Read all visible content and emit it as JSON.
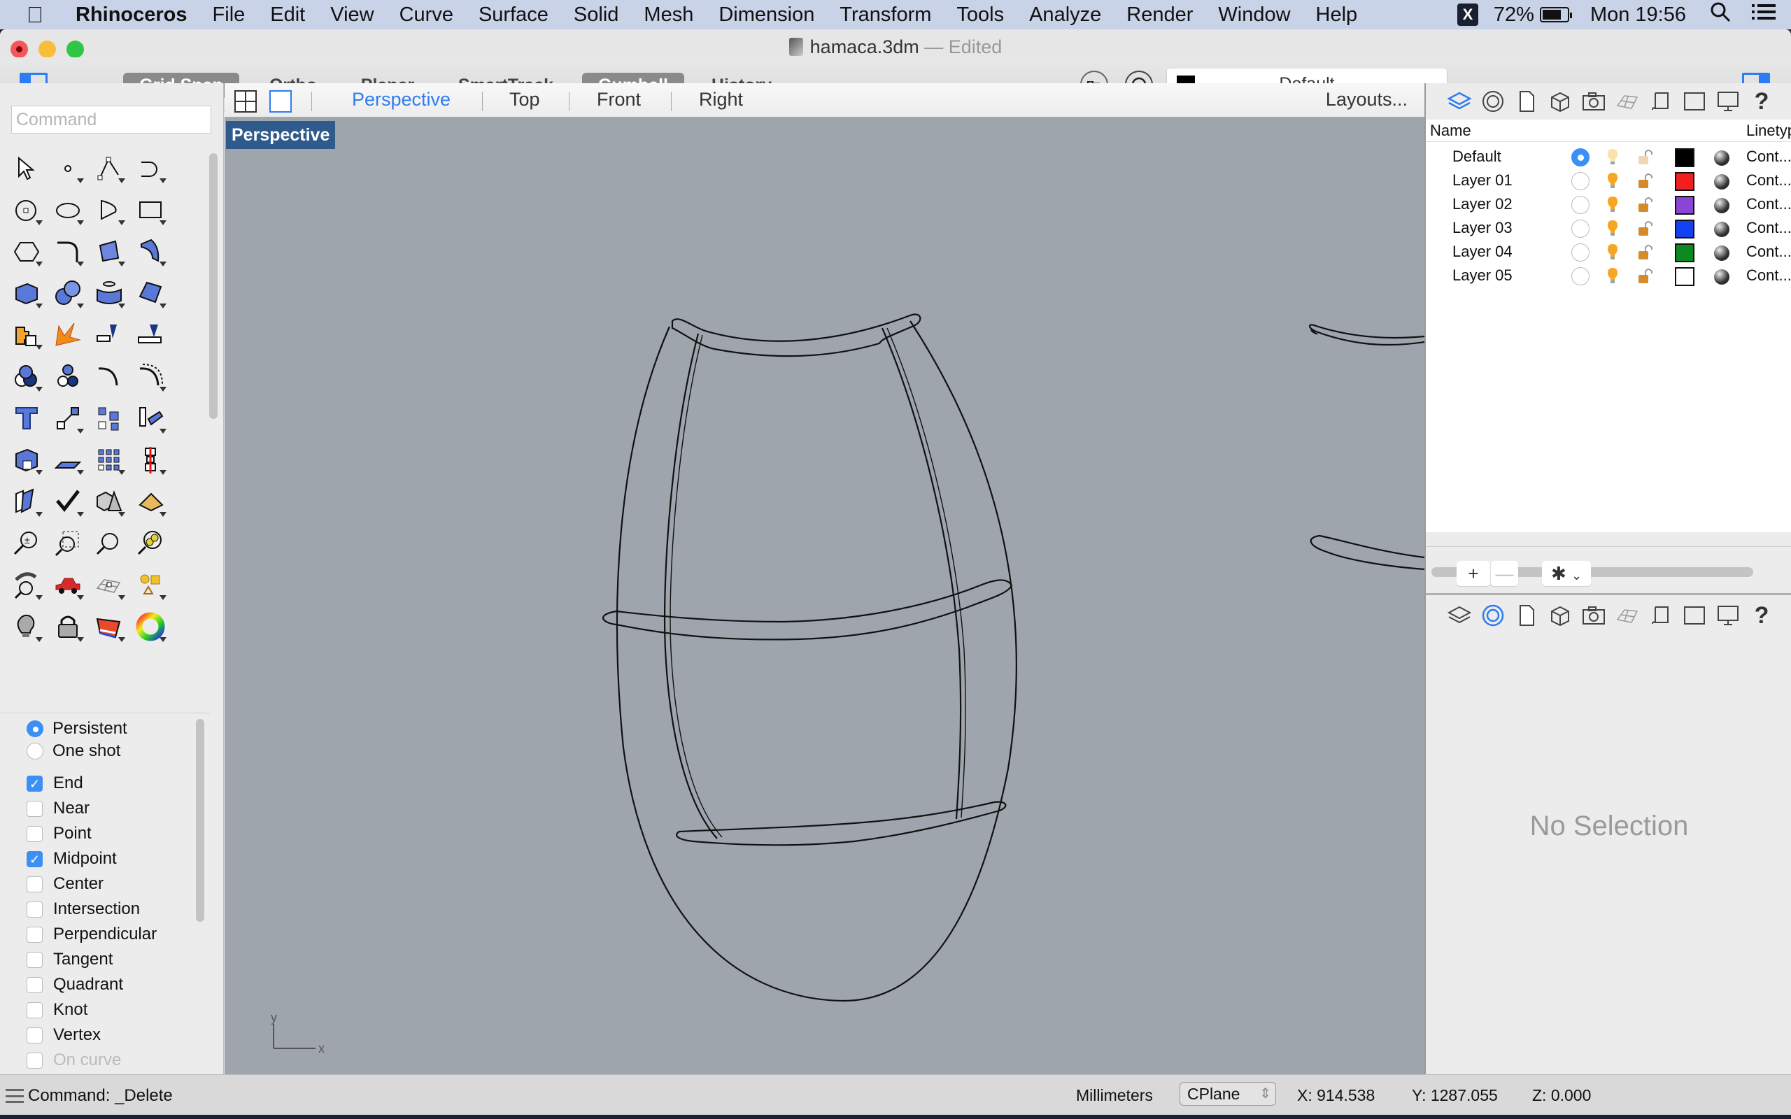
{
  "menubar": {
    "app_name": "Rhinoceros",
    "items": [
      "File",
      "Edit",
      "View",
      "Curve",
      "Surface",
      "Solid",
      "Mesh",
      "Dimension",
      "Transform",
      "Tools",
      "Analyze",
      "Render",
      "Window",
      "Help"
    ],
    "status": {
      "app_icon": "X",
      "battery": "72%",
      "clock": "Mon 19:56"
    }
  },
  "window": {
    "title": "hamaca.3dm",
    "title_suffix": "— Edited"
  },
  "toolbar": {
    "toggles": [
      {
        "label": "Grid Snap",
        "on": true
      },
      {
        "label": "Ortho",
        "on": false
      },
      {
        "label": "Planar",
        "on": false
      },
      {
        "label": "SmartTrack",
        "on": false
      },
      {
        "label": "Gumball",
        "on": true
      },
      {
        "label": "History",
        "on": false
      }
    ],
    "current_layer": {
      "name": "Default",
      "color": "#000000"
    }
  },
  "command": {
    "placeholder": "Command"
  },
  "tool_palette": [
    "select-arrow",
    "point",
    "polyline",
    "curve",
    "circle",
    "ellipse",
    "arc",
    "rectangle",
    "polygon",
    "fillet-curve",
    "surface-from-points",
    "extrude-surface",
    "box",
    "sphere",
    "cylinder",
    "loft",
    "join",
    "explode",
    "trim",
    "split",
    "boolean-union",
    "boolean-split",
    "offset-curve",
    "offset-dashed",
    "text",
    "scale",
    "array",
    "rotate-3d",
    "solid-edit",
    "extrude-planar",
    "grid-array",
    "mirror",
    "twist",
    "check",
    "solid-primitives",
    "pyramid-analysis",
    "zoom-in-out",
    "zoom-window",
    "zoom-extents",
    "zoom-selected",
    "rotate-view",
    "car-render",
    "cplane-grid",
    "shapes",
    "light",
    "lock",
    "layers-material",
    "color-wheel"
  ],
  "osnap": {
    "modes": [
      {
        "label": "Persistent",
        "selected": true
      },
      {
        "label": "One shot",
        "selected": false
      }
    ],
    "items": [
      {
        "label": "End",
        "checked": true
      },
      {
        "label": "Near",
        "checked": false
      },
      {
        "label": "Point",
        "checked": false
      },
      {
        "label": "Midpoint",
        "checked": true
      },
      {
        "label": "Center",
        "checked": false
      },
      {
        "label": "Intersection",
        "checked": false
      },
      {
        "label": "Perpendicular",
        "checked": false
      },
      {
        "label": "Tangent",
        "checked": false
      },
      {
        "label": "Quadrant",
        "checked": false
      },
      {
        "label": "Knot",
        "checked": false
      },
      {
        "label": "Vertex",
        "checked": false
      },
      {
        "label": "On curve",
        "checked": false,
        "disabled": true
      }
    ]
  },
  "viewport_tabs": {
    "tabs": [
      "Perspective",
      "Top",
      "Front",
      "Right"
    ],
    "active": "Perspective",
    "layouts_label": "Layouts..."
  },
  "viewport": {
    "label": "Perspective",
    "axis_x": "x",
    "axis_y": "y",
    "background": "#9fa5ad"
  },
  "layers_panel": {
    "columns": {
      "name": "Name",
      "linetype": "Linetype"
    },
    "layers": [
      {
        "name": "Default",
        "current": true,
        "color": "#000000",
        "linetype": "Cont..."
      },
      {
        "name": "Layer 01",
        "current": false,
        "color": "#f21f1f",
        "linetype": "Cont..."
      },
      {
        "name": "Layer 02",
        "current": false,
        "color": "#8a44d6",
        "linetype": "Cont..."
      },
      {
        "name": "Layer 03",
        "current": false,
        "color": "#1240f2",
        "linetype": "Cont..."
      },
      {
        "name": "Layer 04",
        "current": false,
        "color": "#0a8a20",
        "linetype": "Cont..."
      },
      {
        "name": "Layer 05",
        "current": false,
        "color": "#ffffff",
        "linetype": "Cont..."
      }
    ],
    "add_label": "+",
    "remove_label": "—",
    "gear_label": "✱"
  },
  "properties_panel": {
    "empty_text": "No Selection"
  },
  "statusbar": {
    "command": "Command: _Delete",
    "units": "Millimeters",
    "cplane": "CPlane",
    "x": "X: 914.538",
    "y": "Y: 1287.055",
    "z": "Z: 0.000"
  }
}
